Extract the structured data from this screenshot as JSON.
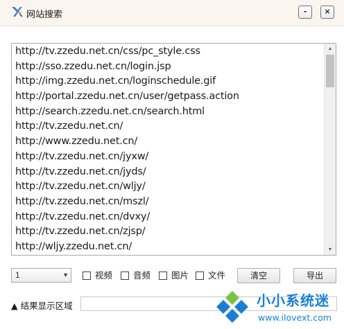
{
  "window": {
    "title": "网站搜索",
    "minimize_label": "-",
    "close_label": "×"
  },
  "urls": [
    "http://tv.zzedu.net.cn/css/pc_style.css",
    "http://sso.zzedu.net.cn/login.jsp",
    "http://img.zzedu.net.cn/loginschedule.gif",
    "http://portal.zzedu.net.cn/user/getpass.action",
    "http://search.zzedu.net.cn/search.html",
    "http://tv.zzedu.net.cn/",
    "http://www.zzedu.net.cn/",
    "http://tv.zzedu.net.cn/jyxw/",
    "http://tv.zzedu.net.cn/jyds/",
    "http://tv.zzedu.net.cn/wljy/",
    "http://tv.zzedu.net.cn/mszl/",
    "http://tv.zzedu.net.cn/dvxy/",
    "http://tv.zzedu.net.cn/zjsp/",
    "http://wljy.zzedu.net.cn/"
  ],
  "controls": {
    "count_value": "1",
    "video_label": "视频",
    "audio_label": "音频",
    "image_label": "图片",
    "file_label": "文件",
    "clear_label": "清空",
    "export_label": "导出"
  },
  "result": {
    "label": "▲ 结果显示区域"
  },
  "watermark": {
    "site_name": "小小系统迷",
    "site_url": "www.ilovext.com"
  },
  "colors": {
    "titlebar": "#faf6ef",
    "watermark_blue": "#1a7fd4",
    "watermark_green": "#7cc242"
  }
}
